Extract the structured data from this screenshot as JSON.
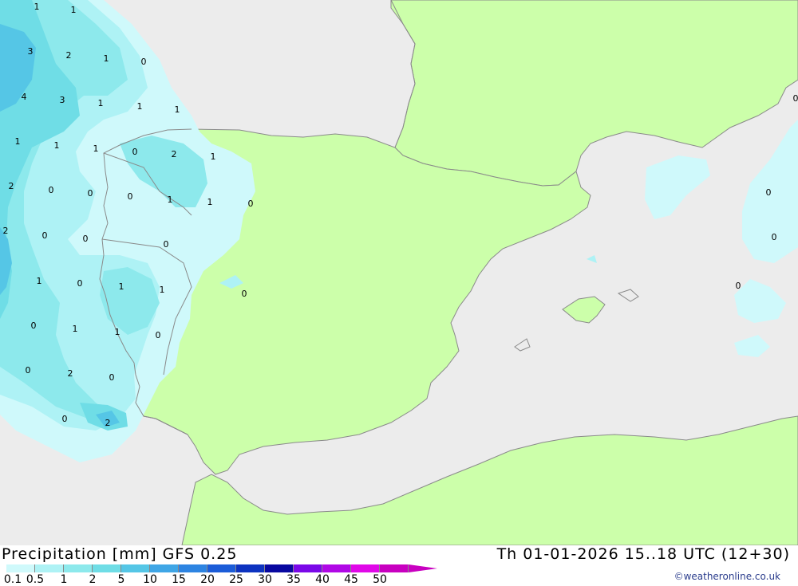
{
  "title": {
    "left": "Precipitation [mm] GFS 0.25",
    "right": "Th 01-01-2026 15..18 UTC (12+30)"
  },
  "credit": "©weatheronline.co.uk",
  "colors": {
    "sea": "#ececec",
    "land": "#ccffaa",
    "coast": "#8a8a8a"
  },
  "legend": {
    "ticks": [
      "0.1",
      "0.5",
      "1",
      "2",
      "5",
      "10",
      "15",
      "20",
      "25",
      "30",
      "35",
      "40",
      "45",
      "50"
    ],
    "colors": [
      "#cff9fb",
      "#aef2f5",
      "#8de9ec",
      "#6fdde6",
      "#55c6e6",
      "#3fa6e6",
      "#2d84e2",
      "#1b5cd8",
      "#0d33c0",
      "#0808a0",
      "#7a08e8",
      "#b008e6",
      "#e008e8",
      "#c800c0"
    ]
  },
  "map_values": [
    {
      "label": "1"
    },
    {
      "label": "1"
    },
    {
      "label": "3"
    },
    {
      "label": "2"
    },
    {
      "label": "1"
    },
    {
      "label": "0"
    },
    {
      "label": "4"
    },
    {
      "label": "3"
    },
    {
      "label": "1"
    },
    {
      "label": "1"
    },
    {
      "label": "1"
    },
    {
      "label": "1"
    },
    {
      "label": "1"
    },
    {
      "label": "1"
    },
    {
      "label": "0"
    },
    {
      "label": "2"
    },
    {
      "label": "1"
    },
    {
      "label": "2"
    },
    {
      "label": "0"
    },
    {
      "label": "0"
    },
    {
      "label": "0"
    },
    {
      "label": "1"
    },
    {
      "label": "1"
    },
    {
      "label": "0"
    },
    {
      "label": "2"
    },
    {
      "label": "0"
    },
    {
      "label": "0"
    },
    {
      "label": "0"
    },
    {
      "label": "1"
    },
    {
      "label": "0"
    },
    {
      "label": "1"
    },
    {
      "label": "1"
    },
    {
      "label": "0"
    },
    {
      "label": "0"
    },
    {
      "label": "1"
    },
    {
      "label": "1"
    },
    {
      "label": "0"
    },
    {
      "label": "0"
    },
    {
      "label": "2"
    },
    {
      "label": "0"
    },
    {
      "label": "0"
    },
    {
      "label": "2"
    },
    {
      "label": "0"
    },
    {
      "label": "0"
    },
    {
      "label": "0"
    },
    {
      "label": "0"
    }
  ]
}
